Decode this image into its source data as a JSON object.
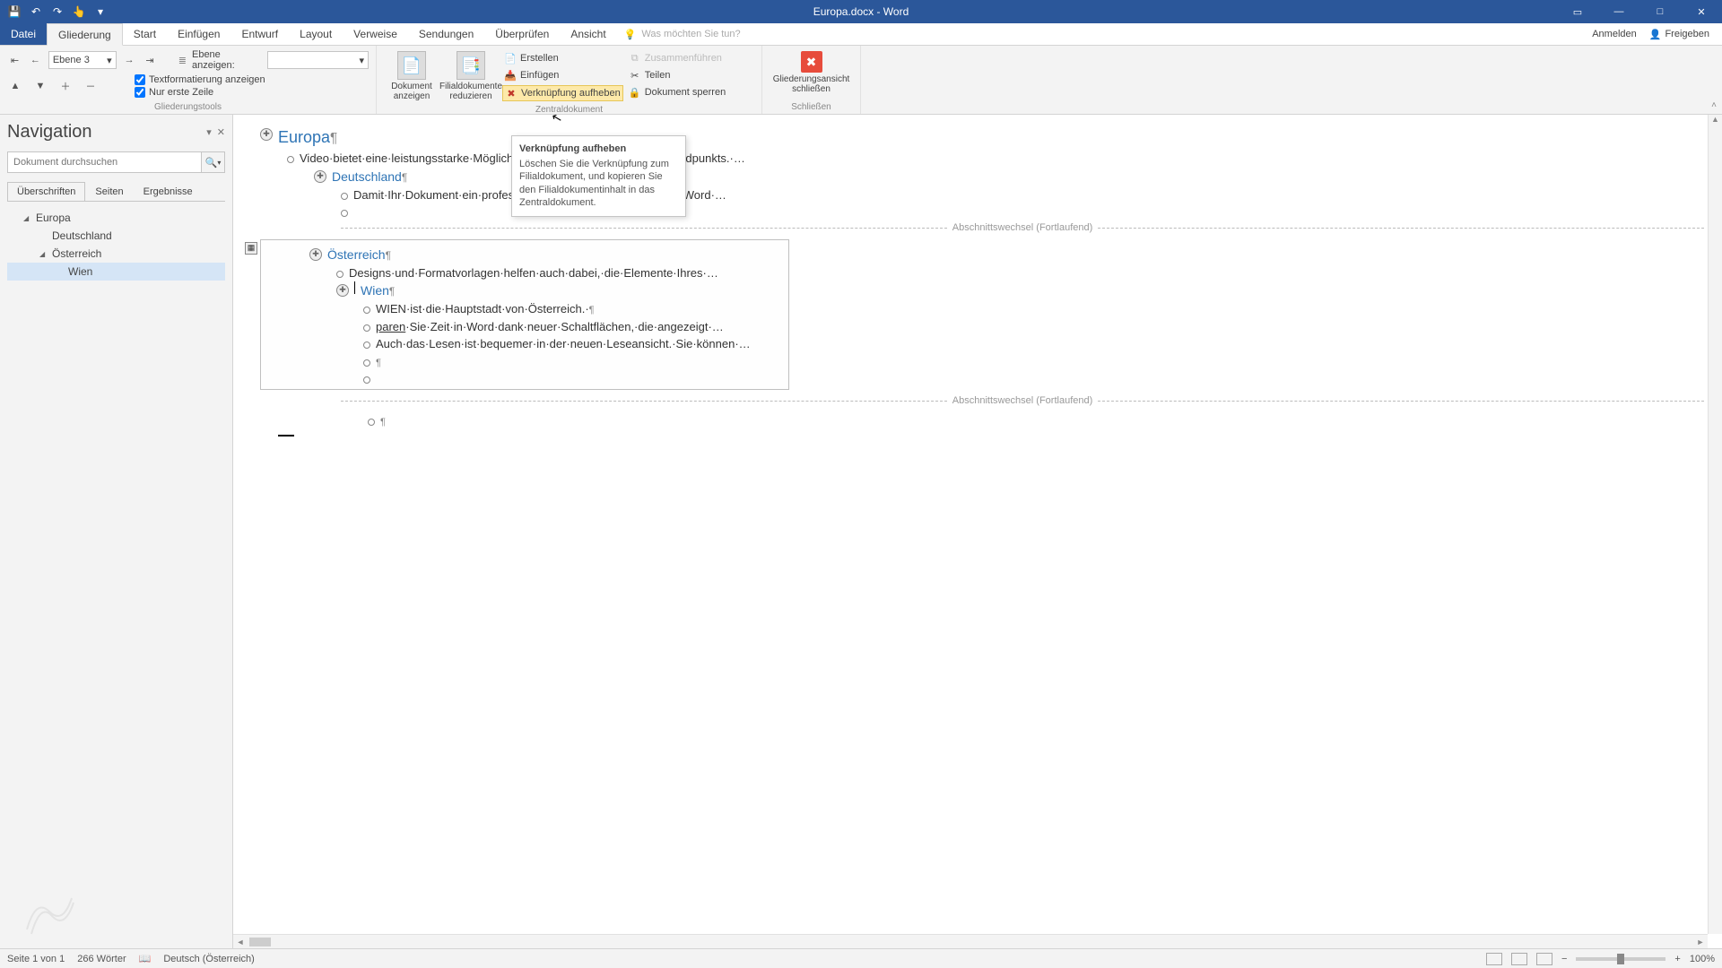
{
  "title": "Europa.docx - Word",
  "qat": {
    "save": "💾",
    "undo": "↶",
    "redo": "↷",
    "touch": "👆"
  },
  "winctrl": {
    "opts": "▭",
    "min": "—",
    "max": "□",
    "close": "✕"
  },
  "tabs": {
    "file": "Datei",
    "outlining": "Gliederung",
    "home": "Start",
    "insert": "Einfügen",
    "draw": "Entwurf",
    "layout": "Layout",
    "references": "Verweise",
    "mailings": "Sendungen",
    "review": "Überprüfen",
    "view": "Ansicht"
  },
  "tellme_placeholder": "Was möchten Sie tun?",
  "signin": "Anmelden",
  "share": "Freigeben",
  "ribbon": {
    "outlinetools_label": "Gliederungstools",
    "level_value": "Ebene 3",
    "show_level_label": "Ebene anzeigen:",
    "show_formatting": "Textformatierung anzeigen",
    "first_line_only": "Nur erste Zeile",
    "show_doc": "Dokument anzeigen",
    "collapse_sub": "Filialdokumente reduzieren",
    "create": "Erstellen",
    "insert": "Einfügen",
    "unlink": "Verknüpfung aufheben",
    "merge": "Zusammenführen",
    "split": "Teilen",
    "lock": "Dokument sperren",
    "master_label": "Zentraldokument",
    "close_outline": "Gliederungsansicht schließen",
    "close_label": "Schließen"
  },
  "tooltip": {
    "title": "Verknüpfung aufheben",
    "body": "Löschen Sie die Verknüpfung zum Filialdokument, und kopieren Sie den Filialdokumentinhalt in das Zentraldokument."
  },
  "nav": {
    "title": "Navigation",
    "search_placeholder": "Dokument durchsuchen",
    "tab_headings": "Überschriften",
    "tab_pages": "Seiten",
    "tab_results": "Ergebnisse",
    "tree": {
      "europa": "Europa",
      "deutschland": "Deutschland",
      "oesterreich": "Österreich",
      "wien": "Wien"
    }
  },
  "doc": {
    "europa": "Europa",
    "line_video": "Video·bietet·eine·leistungsstarke·Möglichkeit·zur·Unterstützung·Ihres·Standpunkts.·…",
    "deutschland": "Deutschland",
    "line_damit": "Damit·Ihr·Dokument·ein·professionelles·Aussehen·erhält,·stellt·Word·…",
    "sectionbreak": "Abschnittswechsel (Fortlaufend)",
    "oesterreich": "Österreich",
    "line_designs": "Designs·und·Formatvorlagen·helfen·auch·dabei,·die·Elemente·Ihres·…",
    "wien": "Wien",
    "line_wien_capital": "WIEN·ist·die·Hauptstadt·von·Österreich.·",
    "line_paren_prefix": "paren",
    "line_paren_rest": "·Sie·Zeit·in·Word·dank·neuer·Schaltflächen,·die·angezeigt·…",
    "line_auch": "Auch·das·Lesen·ist·bequemer·in·der·neuen·Leseansicht.·Sie·können·…"
  },
  "status": {
    "page": "Seite 1 von 1",
    "words": "266 Wörter",
    "lang": "Deutsch (Österreich)",
    "zoom": "100%"
  }
}
